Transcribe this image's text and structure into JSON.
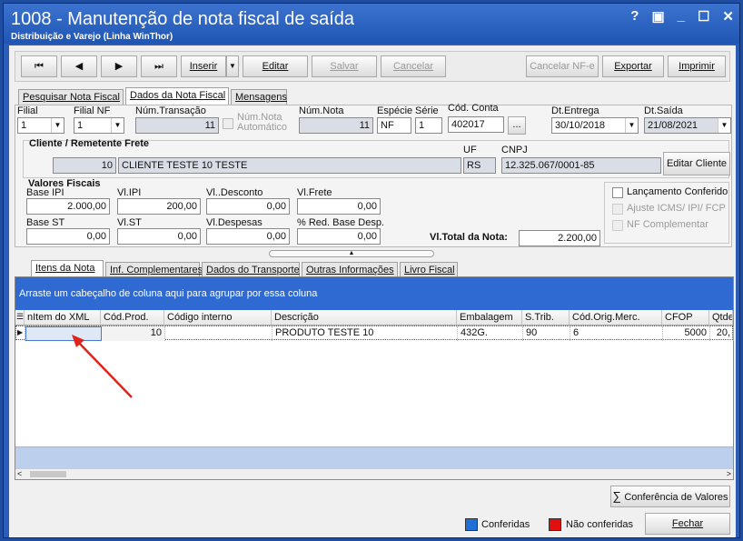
{
  "window": {
    "title": "1008 - Manutenção de nota fiscal de saída",
    "subtitle": "Distribuição e Varejo (Linha WinThor)",
    "controls": [
      "?",
      "▣",
      "_",
      "☐",
      "✕"
    ]
  },
  "toolbar": {
    "first": "⏮",
    "prev": "◀",
    "next": "▶",
    "last": "⏭",
    "inserir": "Inserir",
    "editar": "Editar",
    "salvar": "Salvar",
    "cancelar": "Cancelar",
    "cancelar_nfe": "Cancelar NF-e",
    "exportar": "Exportar",
    "imprimir": "Imprimir"
  },
  "top_tabs": [
    "Pesquisar Nota Fiscal",
    "Dados da Nota Fiscal",
    "Mensagens"
  ],
  "header": {
    "filial_label": "Filial",
    "filial_value": "1",
    "filial_nf_label": "Filial NF",
    "filial_nf_value": "1",
    "num_transacao_label": "Núm.Transação",
    "num_transacao_value": "11",
    "num_nota_auto_label1": "Núm.Nota",
    "num_nota_auto_label2": "Automático",
    "num_nota_label": "Núm.Nota",
    "num_nota_value": "11",
    "especie_label": "Espécie",
    "especie_value": "NF",
    "serie_label": "Série",
    "serie_value": "1",
    "cod_conta_label": "Cód. Conta",
    "cod_conta_value": "402017",
    "cod_conta_btn": "...",
    "dt_entrega_label": "Dt.Entrega",
    "dt_entrega_value": "30/10/2018",
    "dt_saida_label": "Dt.Saída",
    "dt_saida_value": "21/08/2021"
  },
  "cliente": {
    "title": "Cliente / Remetente Frete",
    "code": "10",
    "name": "CLIENTE TESTE 10 TESTE",
    "uf_label": "UF",
    "uf_value": "RS",
    "cnpj_label": "CNPJ",
    "cnpj_value": "12.325.067/0001-85",
    "editar_btn": "Editar Cliente"
  },
  "valores": {
    "title": "Valores Fiscais",
    "base_ipi_label": "Base IPI",
    "base_ipi": "2.000,00",
    "vl_ipi_label": "Vl.IPI",
    "vl_ipi": "200,00",
    "vl_desconto_label": "Vl..Desconto",
    "vl_desconto": "0,00",
    "vl_frete_label": "Vl.Frete",
    "vl_frete": "0,00",
    "base_st_label": "Base ST",
    "base_st": "0,00",
    "vl_st_label": "Vl.ST",
    "vl_st": "0,00",
    "vl_despesas_label": "Vl.Despesas",
    "vl_despesas": "0,00",
    "red_base_label": "% Red. Base Desp.",
    "red_base": "0,00",
    "vl_total_label": "Vl.Total da Nota:",
    "vl_total": "2.200,00"
  },
  "checks": {
    "lancamento": "Lançamento Conferido",
    "ajuste": "Ajuste ICMS/ IPI/ FCP",
    "nf_compl": "NF Complementar"
  },
  "bottom_tabs": [
    "Itens da Nota",
    "Inf. Complementares",
    "Dados do Transporte",
    "Outras Informações",
    "Livro Fiscal"
  ],
  "grid": {
    "group_hint": "Arraste um cabeçalho de coluna aqui para agrupar por essa coluna",
    "columns": [
      "nItem do XML",
      "Cód.Prod.",
      "Código interno",
      "Descrição",
      "Embalagem",
      "S.Trib.",
      "Cód.Orig.Merc.",
      "CFOP",
      "Qtde"
    ],
    "rows": [
      [
        "",
        "10",
        "",
        "PRODUTO TESTE 10",
        "432G.",
        "90",
        "6",
        "5000",
        "20,"
      ]
    ]
  },
  "footer": {
    "conferencia_btn": "Conferência de Valores",
    "legend_conferidas": "Conferidas",
    "legend_nao": "Não conferidas",
    "fechar": "Fechar",
    "color_conferidas": "#1e6fd6",
    "color_nao": "#e01010"
  }
}
